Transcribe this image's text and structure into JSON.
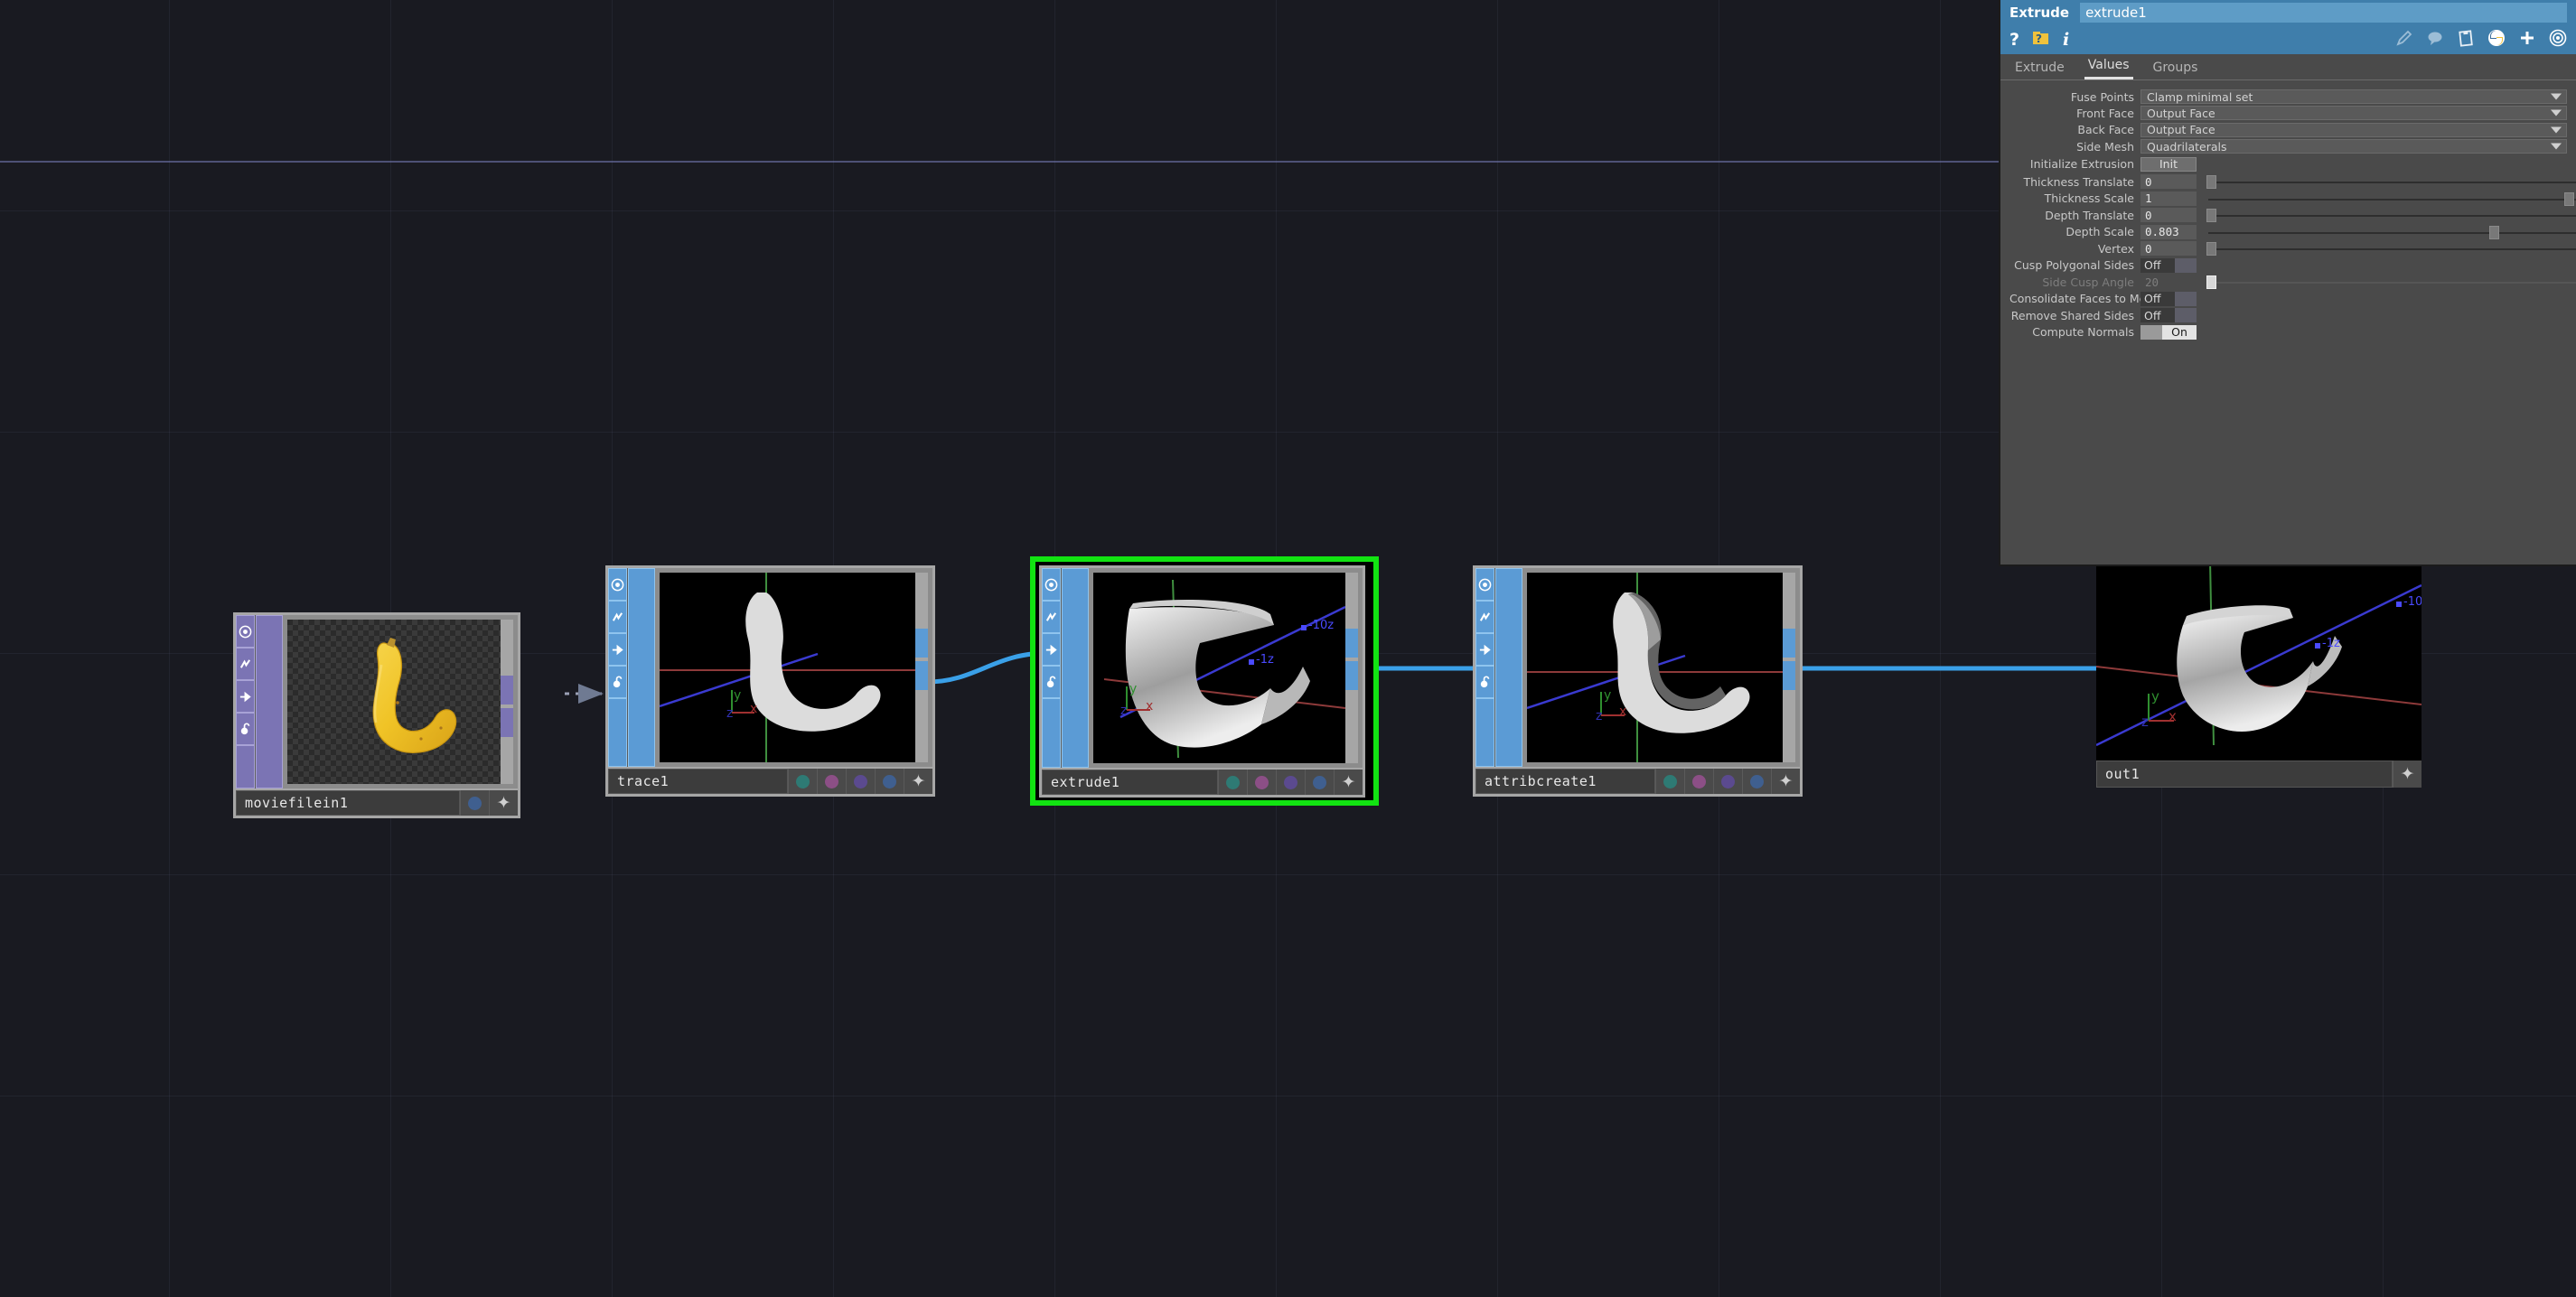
{
  "network": {
    "background_color": "#191a21",
    "selection_color": "#12e312",
    "wire_color": "#3aa0e8",
    "nodes": [
      {
        "id": "moviefilein1",
        "name": "moviefilein1",
        "type": "image-input",
        "selected": false,
        "flag_color": "#7b74b4",
        "flags": [
          "display-icon",
          "render-icon",
          "bypass-icon",
          "lock-icon"
        ],
        "thumbnail": "banana-photo-with-alpha",
        "footer_dots": [
          "#3f5f8f"
        ],
        "has_plus": true
      },
      {
        "id": "trace1",
        "name": "trace1",
        "type": "geometry",
        "selected": false,
        "flag_color": "#5b9bd5",
        "flags": [
          "display-icon",
          "render-icon",
          "bypass-icon",
          "lock-icon"
        ],
        "thumbnail": "banana-silhouette-flat",
        "footer_dots": [
          "#2e7a74",
          "#8c4f86",
          "#5b4a8f",
          "#3f5f8f"
        ],
        "has_plus": true
      },
      {
        "id": "extrude1",
        "name": "extrude1",
        "type": "geometry",
        "selected": true,
        "flag_color": "#5b9bd5",
        "flags": [
          "display-icon",
          "render-icon",
          "bypass-icon",
          "lock-icon"
        ],
        "thumbnail": "banana-extruded-closeup",
        "footer_dots": [
          "#2e7a74",
          "#8c4f86",
          "#5b4a8f",
          "#3f5f8f"
        ],
        "has_plus": true
      },
      {
        "id": "attribcreate1",
        "name": "attribcreate1",
        "type": "geometry",
        "selected": false,
        "flag_color": "#5b9bd5",
        "flags": [
          "display-icon",
          "render-icon",
          "bypass-icon",
          "lock-icon"
        ],
        "thumbnail": "banana-extruded-shaded",
        "footer_dots": [
          "#2e7a74",
          "#8c4f86",
          "#5b4a8f",
          "#3f5f8f"
        ],
        "has_plus": true
      },
      {
        "id": "out1",
        "name": "out1",
        "type": "output",
        "selected": false,
        "thumbnail": "banana-extruded-large",
        "footer_dots": [],
        "has_plus": true
      }
    ],
    "viewport_axis_labels": [
      "x",
      "y",
      "z",
      "-1z",
      "-10z"
    ]
  },
  "params": {
    "node_type_label": "Extrude",
    "node_name": "extrude1",
    "toolbar_left": [
      "help-icon",
      "node-help-icon",
      "info-icon"
    ],
    "toolbar_right": [
      "pencil-icon",
      "comment-icon",
      "clipboard-icon",
      "python-icon",
      "plus-icon",
      "target-icon"
    ],
    "tabs": [
      {
        "label": "Extrude",
        "active": false
      },
      {
        "label": "Values",
        "active": true
      },
      {
        "label": "Groups",
        "active": false
      }
    ],
    "rows": [
      {
        "kind": "menu",
        "label": "Fuse Points",
        "value": "Clamp minimal set"
      },
      {
        "kind": "menu",
        "label": "Front Face",
        "value": "Output Face"
      },
      {
        "kind": "menu",
        "label": "Back Face",
        "value": "Output Face"
      },
      {
        "kind": "menu",
        "label": "Side Mesh",
        "value": "Quadrilaterals"
      },
      {
        "kind": "button",
        "label": "Initialize Extrusion",
        "value": "Init"
      },
      {
        "kind": "slider",
        "label": "Thickness Translate",
        "value": "0",
        "pos": 2
      },
      {
        "kind": "slider",
        "label": "Thickness Scale",
        "value": "1",
        "pos": 97
      },
      {
        "kind": "slider",
        "label": "Depth Translate",
        "value": "0",
        "pos": 2
      },
      {
        "kind": "slider",
        "label": "Depth Scale",
        "value": "0.803",
        "pos": 77
      },
      {
        "kind": "slider",
        "label": "Vertex",
        "value": "0",
        "pos": 2
      },
      {
        "kind": "toggle",
        "label": "Cusp Polygonal Sides",
        "value": "Off"
      },
      {
        "kind": "slider",
        "label": "Side Cusp Angle",
        "value": "20",
        "pos": 2,
        "disabled": true
      },
      {
        "kind": "toggle",
        "label": "Consolidate Faces to Mesh",
        "value": "Off"
      },
      {
        "kind": "toggle",
        "label": "Remove Shared Sides",
        "value": "Off"
      },
      {
        "kind": "toggle",
        "label": "Compute Normals",
        "value": "On"
      }
    ]
  }
}
